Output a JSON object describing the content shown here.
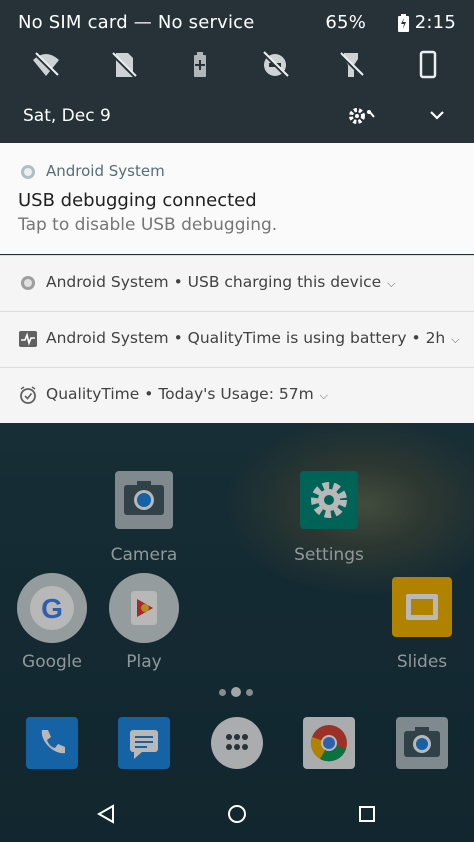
{
  "status_bar": {
    "carrier": "No SIM card — No service",
    "battery": "65%",
    "time": "2:15"
  },
  "quick_settings": {
    "tiles": [
      "wifi-off-icon",
      "no-sim-icon",
      "battery-saver-icon",
      "do-not-disturb-off-icon",
      "flashlight-off-icon",
      "phone-portrait-icon"
    ],
    "date": "Sat, Dec 9"
  },
  "notifications": {
    "usb_debug": {
      "app": "Android System",
      "title": "USB debugging connected",
      "text": "Tap to disable USB debugging."
    },
    "usb_charging": {
      "text": "Android System • USB charging this device"
    },
    "battery_use": {
      "text": "Android System • QualityTime is using battery • 2h"
    },
    "quality_time": {
      "text": "QualityTime • Today's Usage: 57m"
    }
  },
  "home": {
    "apps": {
      "camera": "Camera",
      "settings": "Settings",
      "google": "Google",
      "play": "Play",
      "slides": "Slides"
    }
  },
  "colors": {
    "notif_bg": "#f5f5f5",
    "qs_bg": "#263238"
  }
}
